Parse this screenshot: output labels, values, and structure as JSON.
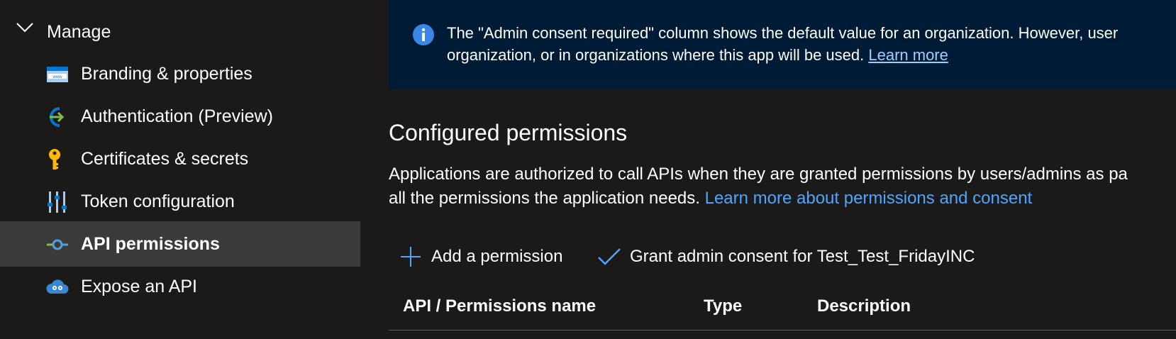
{
  "sidebar": {
    "group_label": "Manage",
    "items": [
      {
        "label": "Branding & properties",
        "icon": "branding-icon",
        "selected": false
      },
      {
        "label": "Authentication (Preview)",
        "icon": "authentication-icon",
        "selected": false
      },
      {
        "label": "Certificates & secrets",
        "icon": "key-icon",
        "selected": false
      },
      {
        "label": "Token configuration",
        "icon": "token-config-icon",
        "selected": false
      },
      {
        "label": "API permissions",
        "icon": "api-permissions-icon",
        "selected": true
      },
      {
        "label": "Expose an API",
        "icon": "cloud-icon",
        "selected": false
      }
    ]
  },
  "banner": {
    "line1": "The \"Admin consent required\" column shows the default value for an organization. However, user",
    "line2": "organization, or in organizations where this app will be used.",
    "link": "Learn more"
  },
  "section": {
    "title": "Configured permissions",
    "desc_line1": "Applications are authorized to call APIs when they are granted permissions by users/admins as pa",
    "desc_line2": "all the permissions the application needs.",
    "desc_link": "Learn more about permissions and consent"
  },
  "toolbar": {
    "add_label": "Add a permission",
    "grant_label": "Grant admin consent for Test_Test_FridayINC"
  },
  "table": {
    "headers": [
      "API / Permissions name",
      "Type",
      "Description"
    ]
  },
  "colors": {
    "background": "#1b1a19",
    "selected": "#3b3a39",
    "banner": "#001b36",
    "link": "#4ca6ff",
    "accent": "#0078d4"
  }
}
